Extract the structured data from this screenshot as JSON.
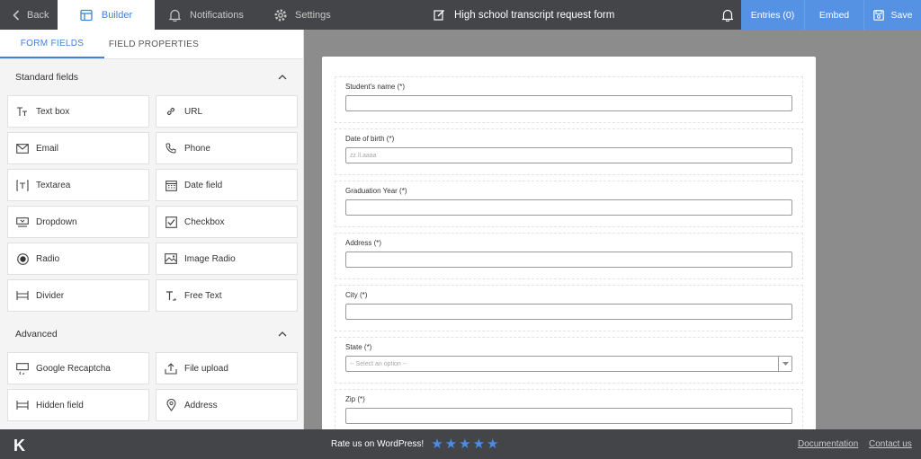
{
  "topbar": {
    "back_label": "Back",
    "builder_label": "Builder",
    "notifications_label": "Notifications",
    "settings_label": "Settings",
    "form_title": "High school transcript request form",
    "entries_label": "Entries (0)",
    "embed_label": "Embed",
    "save_label": "Save"
  },
  "sidebar": {
    "tabs": [
      "FORM FIELDS",
      "FIELD PROPERTIES"
    ],
    "standard_title": "Standard fields",
    "standard_fields": [
      {
        "label": "Text box",
        "icon": "text-box-icon"
      },
      {
        "label": "URL",
        "icon": "link-icon"
      },
      {
        "label": "Email",
        "icon": "envelope-icon"
      },
      {
        "label": "Phone",
        "icon": "phone-icon"
      },
      {
        "label": "Textarea",
        "icon": "textarea-icon"
      },
      {
        "label": "Date field",
        "icon": "calendar-icon"
      },
      {
        "label": "Dropdown",
        "icon": "dropdown-icon"
      },
      {
        "label": "Checkbox",
        "icon": "checkbox-icon"
      },
      {
        "label": "Radio",
        "icon": "radio-icon"
      },
      {
        "label": "Image Radio",
        "icon": "image-icon"
      },
      {
        "label": "Divider",
        "icon": "divider-icon"
      },
      {
        "label": "Free Text",
        "icon": "free-text-icon"
      }
    ],
    "advanced_title": "Advanced",
    "advanced_fields": [
      {
        "label": "Google Recaptcha",
        "icon": "recaptcha-icon"
      },
      {
        "label": "File upload",
        "icon": "upload-icon"
      },
      {
        "label": "Hidden field",
        "icon": "hidden-field-icon"
      },
      {
        "label": "Address",
        "icon": "location-pin-icon"
      }
    ]
  },
  "form": {
    "fields": [
      {
        "label": "Student's name (*)",
        "type": "text",
        "placeholder": ""
      },
      {
        "label": "Date of birth (*)",
        "type": "text",
        "placeholder": "zz.ll.aaaa"
      },
      {
        "label": "Graduation Year (*)",
        "type": "text",
        "placeholder": ""
      },
      {
        "label": "Address (*)",
        "type": "text",
        "placeholder": ""
      },
      {
        "label": "City (*)",
        "type": "text",
        "placeholder": ""
      },
      {
        "label": "State (*)",
        "type": "select",
        "placeholder": "-- Select an option --"
      },
      {
        "label": "Zip (*)",
        "type": "text",
        "placeholder": ""
      }
    ]
  },
  "footer": {
    "logo": "K",
    "rate_label": "Rate us on WordPress!",
    "stars": 5,
    "documentation_label": "Documentation",
    "contact_label": "Contact us"
  },
  "colors": {
    "topbar": "#444548",
    "accent": "#5592e4",
    "active_tab": "#3f82d8"
  }
}
